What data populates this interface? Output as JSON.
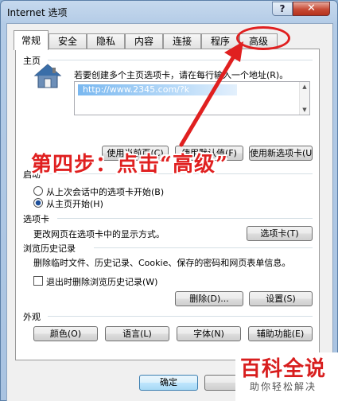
{
  "window": {
    "title": "Internet 选项",
    "help_label": "?",
    "close_label": "✕"
  },
  "tabs": [
    {
      "label": "常规",
      "active": true
    },
    {
      "label": "安全",
      "active": false
    },
    {
      "label": "隐私",
      "active": false
    },
    {
      "label": "内容",
      "active": false
    },
    {
      "label": "连接",
      "active": false
    },
    {
      "label": "程序",
      "active": false
    },
    {
      "label": "高级",
      "active": false
    }
  ],
  "homepage": {
    "section_label": "主页",
    "description": "若要创建多个主页选项卡，请在每行输入一个地址(R)。",
    "url_value": "http://www.2345.com/?k",
    "buttons": {
      "use_current": "使用当前页(C)",
      "use_default": "使用默认值(F)",
      "use_new_tab": "使用新选项卡(U)"
    }
  },
  "startup": {
    "section_label": "启动",
    "option_last_session": "从上次会话中的选项卡开始(B)",
    "option_home": "从主页开始(H)"
  },
  "tabs_section": {
    "section_label": "选项卡",
    "description": "更改网页在选项卡中的显示方式。",
    "button": "选项卡(T)"
  },
  "history": {
    "section_label": "浏览历史记录",
    "description": "删除临时文件、历史记录、Cookie、保存的密码和网页表单信息。",
    "checkbox_label": "退出时删除浏览历史记录(W)",
    "checkbox_checked": false,
    "delete_button": "删除(D)...",
    "settings_button": "设置(S)"
  },
  "appearance": {
    "section_label": "外观",
    "colors_button": "颜色(O)",
    "languages_button": "语言(L)",
    "fonts_button": "字体(N)",
    "accessibility_button": "辅助功能(E)"
  },
  "footer": {
    "ok_button": "确定"
  },
  "annotation": {
    "step_text": "第四步：点击“高级”",
    "color": "#e02020"
  },
  "watermark": {
    "main": "百科全说",
    "sub": "助你轻松解决"
  }
}
